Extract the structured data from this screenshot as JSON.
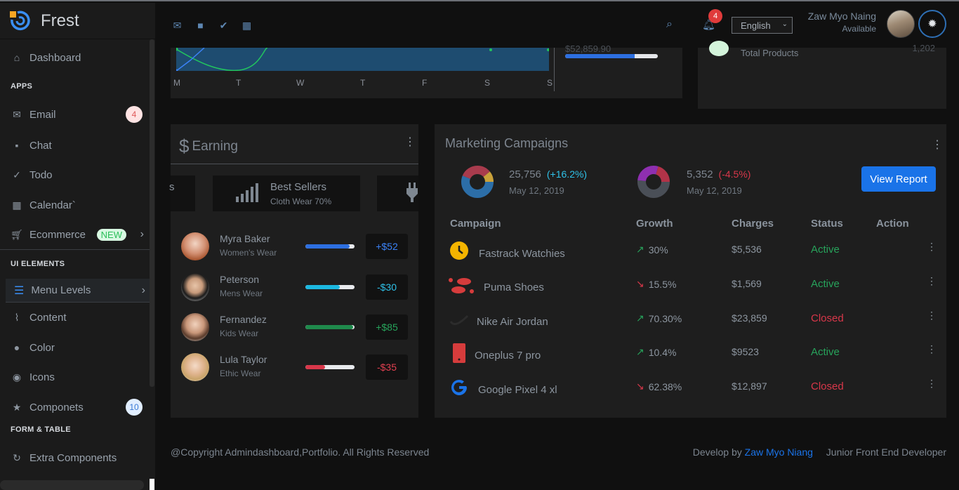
{
  "brand": {
    "name": "Frest"
  },
  "sidebar": {
    "dashboard": "Dashboard",
    "apps_heading": "APPS",
    "email": "Email",
    "email_badge": "4",
    "chat": "Chat",
    "todo": "Todo",
    "calendar": "Calendar`",
    "ecommerce": "Ecommerce",
    "ecommerce_badge": "NEW",
    "ui_heading": "UI ELEMENTS",
    "menu_levels": "Menu Levels",
    "content": "Content",
    "color": "Color",
    "icons": "Icons",
    "components": "Componets",
    "components_badge": "10",
    "form_heading": "FORM & TABLE",
    "extra": "Extra Components"
  },
  "header": {
    "notification_count": "4",
    "language": "English",
    "user_name": "Zaw Myo Naing",
    "user_status": "Available",
    "icons": [
      "mail-icon",
      "chat-icon",
      "check-circle-icon",
      "calendar-icon",
      "search-icon",
      "bell-icon",
      "gear-icon"
    ]
  },
  "chart_card": {
    "days": [
      "M",
      "T",
      "W",
      "T",
      "F",
      "S",
      "S"
    ],
    "amount_partial": "$52,859.90",
    "progress": 0.75
  },
  "total_card": {
    "label": "Total Products",
    "value_partial": "1,202"
  },
  "earning": {
    "title": "Earning",
    "slider_prev_partial": "s",
    "best_sellers_title": "Best Sellers",
    "best_sellers_sub": "Cloth Wear 70%",
    "sellers": [
      {
        "name": "Myra Baker",
        "category": "Women's Wear",
        "amount": "+$52",
        "progress": 0.9,
        "bar_color": "#2d6fe0",
        "amount_color": "#3b82f6"
      },
      {
        "name": "Peterson",
        "category": "Mens Wear",
        "amount": "-$30",
        "progress": 0.7,
        "bar_color": "#1cb8e0",
        "amount_color": "#2fc1e8"
      },
      {
        "name": "Fernandez",
        "category": "Kids Wear",
        "amount": "+$85",
        "progress": 0.97,
        "bar_color": "#1f8a4c",
        "amount_color": "#27a35b"
      },
      {
        "name": "Lula Taylor",
        "category": "Ethic Wear",
        "amount": "-$35",
        "progress": 0.4,
        "bar_color": "#d9374a",
        "amount_color": "#e04050"
      }
    ]
  },
  "marketing": {
    "title": "Marketing Campaigns",
    "stat1": {
      "value": "25,756",
      "pct": "(+16.2%)",
      "date": "May 12, 2019",
      "pct_color": "#2fc1e8"
    },
    "stat2": {
      "value": "5,352",
      "pct": "(-4.5%)",
      "date": "May 12, 2019",
      "pct_color": "#d9374a"
    },
    "report_button": "View Report",
    "columns": [
      "Campaign",
      "Growth",
      "Charges",
      "Status",
      "Action"
    ],
    "rows": [
      {
        "icon": "clock-icon",
        "name": "Fastrack Watchies",
        "growth": "30%",
        "trend": "up",
        "charges": "$5,536",
        "status": "Active"
      },
      {
        "icon": "footprints-icon",
        "name": "Puma Shoes",
        "growth": "15.5%",
        "trend": "down",
        "charges": "$1,569",
        "status": "Active"
      },
      {
        "icon": "swoosh-icon",
        "name": "Nike Air Jordan",
        "growth": "70.30%",
        "trend": "up",
        "charges": "$23,859",
        "status": "Closed"
      },
      {
        "icon": "phone-icon",
        "name": "Oneplus 7 pro",
        "growth": "10.4%",
        "trend": "up",
        "charges": "$9523",
        "status": "Active"
      },
      {
        "icon": "google-icon",
        "name": "Google Pixel 4 xl",
        "growth": "62.38%",
        "trend": "down",
        "charges": "$12,897",
        "status": "Closed"
      }
    ]
  },
  "footer": {
    "copyright": "@Copyright Admindashboard,Portfolio. All Rights Reserved",
    "develop_by": "Develop by",
    "developer": "Zaw Myo Niang",
    "role": "Junior Front End Developer"
  },
  "colors": {
    "accent": "#1a73e8",
    "active": "#27a35b",
    "closed": "#d9374a",
    "sidebar_bg": "#1b1b1b",
    "card_bg": "#1e1e1e"
  }
}
